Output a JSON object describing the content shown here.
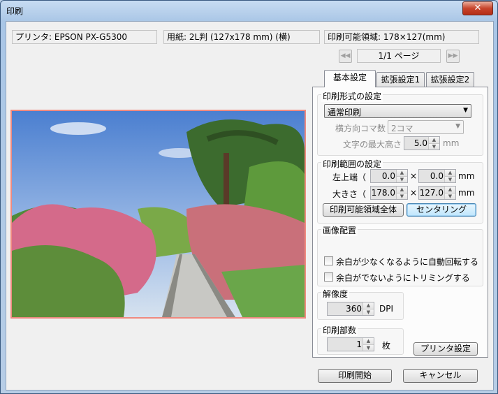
{
  "window": {
    "title": "印刷",
    "close_glyph": "✕"
  },
  "info": {
    "printer": "プリンタ: EPSON PX-G5300",
    "paper": "用紙: 2L判 (127x178 mm) (横)",
    "printable_area": "印刷可能領域: 178×127(mm)"
  },
  "pager": {
    "text": "1/1 ページ",
    "prev_glyph": "◀◀",
    "next_glyph": "▶▶"
  },
  "tabs": [
    {
      "label": "基本設定",
      "active": true
    },
    {
      "label": "拡張設定1",
      "active": false
    },
    {
      "label": "拡張設定2",
      "active": false
    }
  ],
  "print_format": {
    "title": "印刷形式の設定",
    "mode": "通常印刷",
    "frames_label": "横方向コマ数",
    "frames_value": "2コマ",
    "max_text_label": "文字の最大高さ",
    "max_text_value": "5.0",
    "max_text_unit": "mm"
  },
  "print_range": {
    "title": "印刷範囲の設定",
    "top_left_label": "左上端（",
    "top_left_x": "0.0",
    "top_left_y": "0.0",
    "size_label": "大きさ（",
    "size_w": "178.0",
    "size_h": "127.0",
    "times": "×",
    "unit": "mm",
    "full_area_button": "印刷可能領域全体",
    "centering_button": "センタリング"
  },
  "placement": {
    "title": "画像配置",
    "auto_rotate": "余白が少なくなるように自動回転する",
    "trimming": "余白がでないようにトリミングする"
  },
  "resolution": {
    "title": "解像度",
    "value": "360",
    "unit": "DPI"
  },
  "copies": {
    "title": "印刷部数",
    "value": "1",
    "unit": "枚"
  },
  "buttons": {
    "printer_settings": "プリンタ設定",
    "start": "印刷開始",
    "cancel": "キャンセル"
  }
}
